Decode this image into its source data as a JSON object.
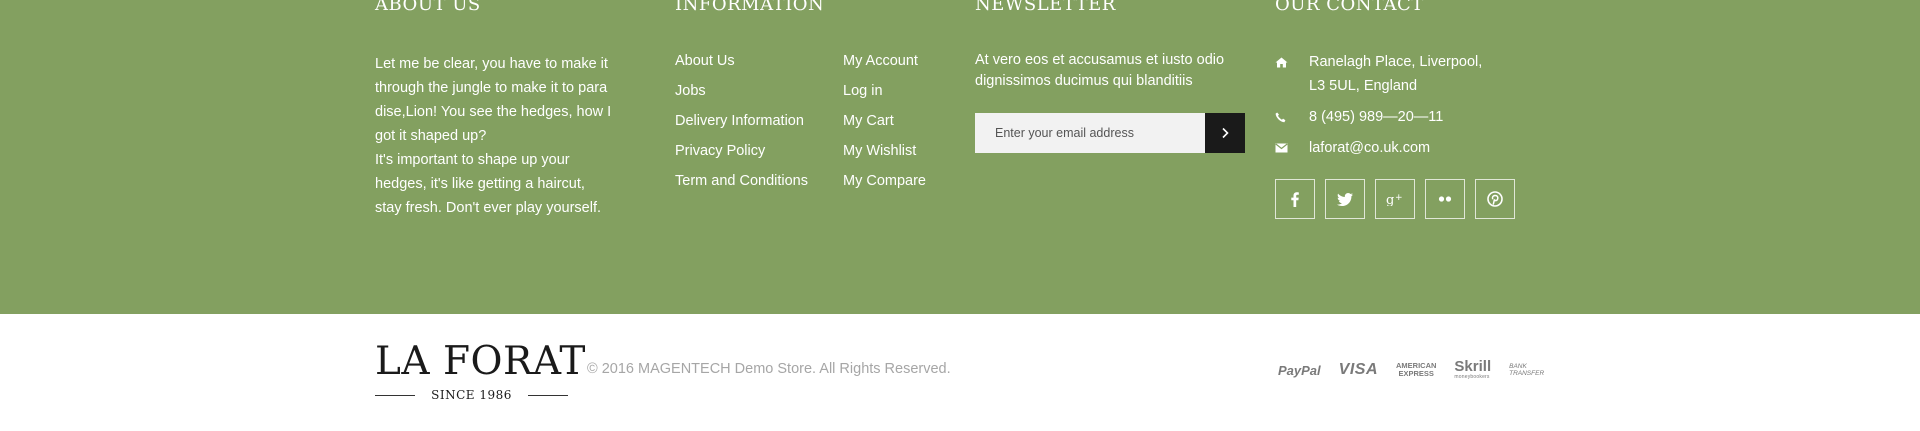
{
  "about": {
    "title": "ABOUT US",
    "paragraph1": "Let me be clear, you have to make it through the jungle to make it to para dise,Lion! You see the hedges, how I got it shaped up?",
    "paragraph2": "It's important to shape up your hedges, it's like getting a haircut, stay fresh. Don't ever play yourself."
  },
  "information": {
    "title": "INFORMATION",
    "list1": [
      "About Us",
      "Jobs",
      "Delivery Information",
      "Privacy Policy",
      "Term and Conditions"
    ],
    "list2": [
      "My Account",
      "Log in",
      "My Cart",
      "My Wishlist",
      "My Compare"
    ]
  },
  "newsletter": {
    "title": "NEWSLETTER",
    "text": "At vero eos et accusamus et iusto odio dignissimos ducimus qui blanditiis",
    "placeholder": "Enter your email address",
    "submit_icon": "chevron-right-icon"
  },
  "contact": {
    "title": "OUR CONTACT",
    "address_line1": "Ranelagh Place, Liverpool,",
    "address_line2": "L3 5UL, England",
    "phone": "8 (495) 989—20—11",
    "email": "laforat@co.uk.com",
    "icons": [
      "home-icon",
      "phone-icon",
      "envelope-icon"
    ],
    "social": [
      "facebook-icon",
      "twitter-icon",
      "google-plus-icon",
      "flickr-icon",
      "pinterest-icon"
    ]
  },
  "bottom": {
    "brand_name": "LA FORAT",
    "brand_since": "SINCE 1986",
    "copyright": "© 2016 MAGENTECH Demo Store. All Rights Reserved.",
    "payments": {
      "paypal": "PayPal",
      "visa": "VISA",
      "amex_line1": "AMERICAN",
      "amex_line2": "EXPRESS",
      "skrill": "Skrill",
      "skrill_sub": "moneybookers",
      "bank_line1": "BANK",
      "bank_line2": "TRANSFER"
    }
  },
  "colors": {
    "footer_bg": "#83a060",
    "bottom_bg": "#ffffff",
    "submit_bg": "#1a1a1a",
    "copyright_text": "#a6a6a6"
  }
}
